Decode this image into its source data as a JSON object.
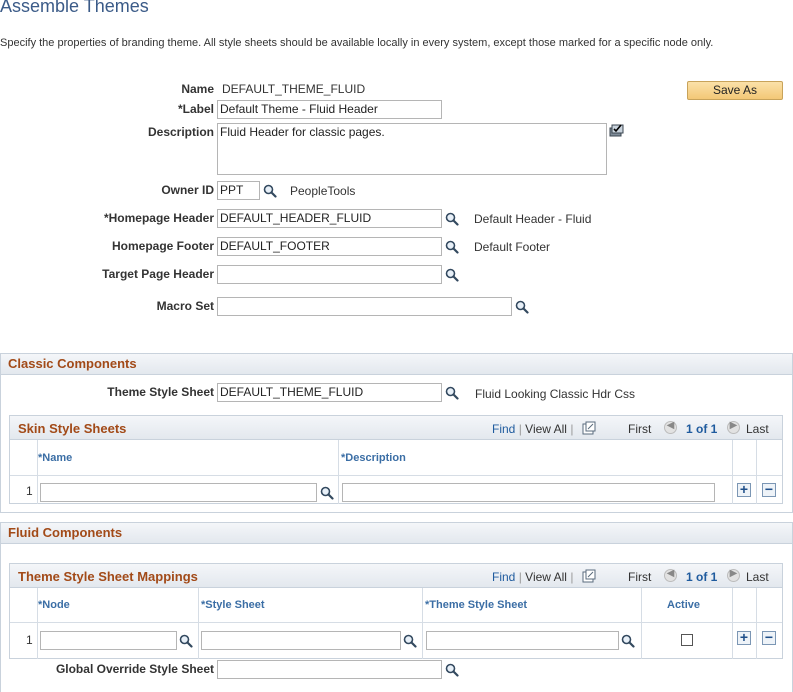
{
  "page": {
    "title": "Assemble Themes",
    "instructions": "Specify the properties of branding theme. All style sheets should be available locally in every system, except those marked for a specific node only."
  },
  "form": {
    "name_label": "Name",
    "name_value": "DEFAULT_THEME_FLUID",
    "label_label": "*Label",
    "label_value": "Default Theme - Fluid Header",
    "description_label": "Description",
    "description_value": "Fluid Header for classic pages.",
    "owner_label": "Owner ID",
    "owner_value": "PPT",
    "owner_desc": "PeopleTools",
    "header_label": "*Homepage Header",
    "header_value": "DEFAULT_HEADER_FLUID",
    "header_desc": "Default Header - Fluid",
    "footer_label": "Homepage Footer",
    "footer_value": "DEFAULT_FOOTER",
    "footer_desc": "Default Footer",
    "target_label": "Target Page Header",
    "target_value": "",
    "macro_label": "Macro Set",
    "macro_value": "",
    "save_as": "Save As"
  },
  "classic": {
    "title": "Classic Components",
    "theme_label": "Theme Style Sheet",
    "theme_value": "DEFAULT_THEME_FLUID",
    "theme_desc": "Fluid Looking Classic Hdr Css",
    "grid": {
      "title": "Skin Style Sheets",
      "find": "Find",
      "sep": "|",
      "view_all": "View All",
      "first": "First",
      "range": "1 of 1",
      "last": "Last",
      "col_name": "*Name",
      "col_desc": "*Description",
      "row_num": "1",
      "name_value": "",
      "desc_value": ""
    }
  },
  "fluid": {
    "title": "Fluid Components",
    "grid": {
      "title": "Theme Style Sheet Mappings",
      "find": "Find",
      "sep": "|",
      "view_all": "View All",
      "first": "First",
      "range": "1 of 1",
      "last": "Last",
      "col_node": "*Node",
      "col_style": "*Style Sheet",
      "col_theme": "*Theme Style Sheet",
      "col_active": "Active",
      "row_num": "1"
    },
    "override_label": "Global Override Style Sheet",
    "override_value": ""
  },
  "icons": {
    "lookup": "magnifier",
    "spell": "spell-check",
    "prev": "◀",
    "next": "▶",
    "add": "+",
    "remove": "−",
    "zoom": "grid-zoom"
  },
  "colors": {
    "title_blue": "#3b5b88",
    "section_orange": "#a24a18",
    "column_blue": "#3b6ea5",
    "link_blue": "#1f5b9e",
    "button_gold": "#f3c877"
  }
}
